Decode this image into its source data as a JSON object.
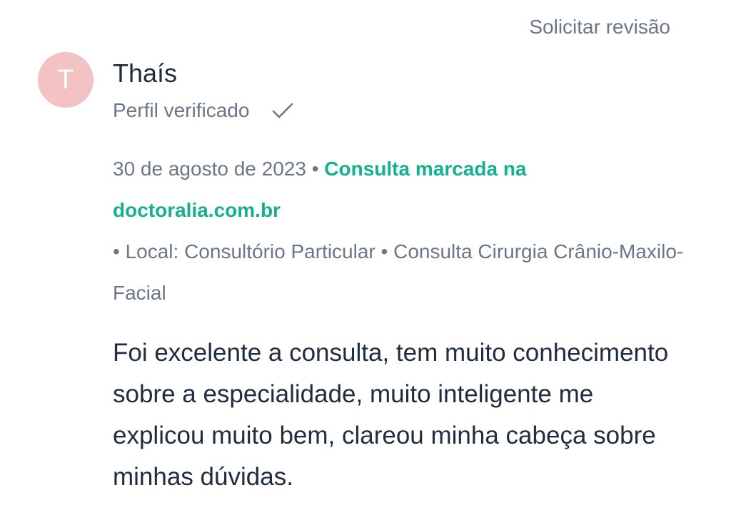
{
  "review_request_label": "Solicitar revisão",
  "author": {
    "initial": "T",
    "name": "Thaís",
    "verified_label": "Perfil verificado"
  },
  "meta": {
    "date": "30 de agosto de 2023",
    "separator": " • ",
    "booking_source": "Consulta marcada na doctoralia.com.br",
    "details": "• Local: Consultório Particular • Consulta Cirurgia Crânio-Maxilo-Facial"
  },
  "review_text": "Foi excelente a consulta, tem muito conhecimento sobre a especialidade, muito inteligente me explicou muito bem, clareou minha cabeça sobre minhas dúvidas.",
  "colors": {
    "accent_green": "#17b08f",
    "avatar_bg": "#f3c2c2",
    "muted_text": "#6b7785",
    "primary_text": "#1f2d3d"
  }
}
